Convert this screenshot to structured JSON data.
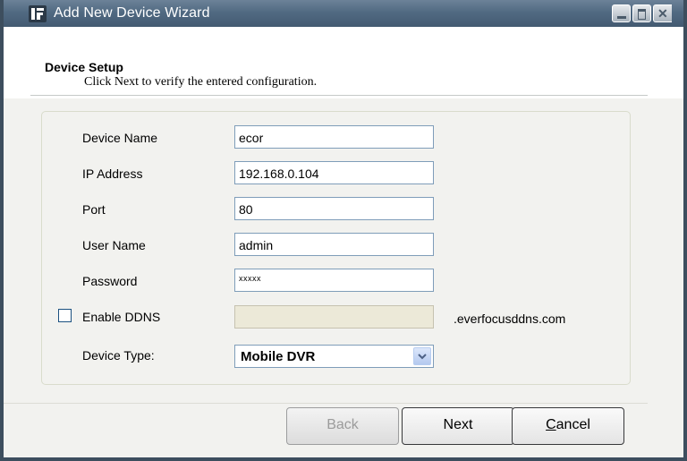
{
  "window": {
    "title": "Add New Device Wizard",
    "controls": {
      "minimize": "minimize-icon",
      "maximize": "maximize-icon",
      "close": "close-icon"
    }
  },
  "header": {
    "title": "Device Setup",
    "subtitle": "Click Next to verify the entered configuration."
  },
  "form": {
    "device_name": {
      "label": "Device Name",
      "value": "ecor"
    },
    "ip_address": {
      "label": "IP Address",
      "value": "192.168.0.104"
    },
    "port": {
      "label": "Port",
      "value": "80"
    },
    "user_name": {
      "label": "User Name",
      "value": "admin"
    },
    "password": {
      "label": "Password",
      "value": "xxxxx"
    },
    "ddns": {
      "label": "Enable DDNS",
      "checked": false,
      "value": "",
      "suffix": ".everfocusddns.com"
    },
    "device_type": {
      "label": "Device Type:",
      "value": "Mobile DVR"
    }
  },
  "buttons": {
    "back": "Back",
    "next": "Next",
    "cancel_first": "C",
    "cancel_rest": "ancel"
  },
  "colors": {
    "titlebar": "#516a82",
    "window_border": "#3d4e5e",
    "dialog_bg": "#f2f2ef",
    "field_border": "#7f9db9",
    "disabled_field": "#ece9d8"
  }
}
